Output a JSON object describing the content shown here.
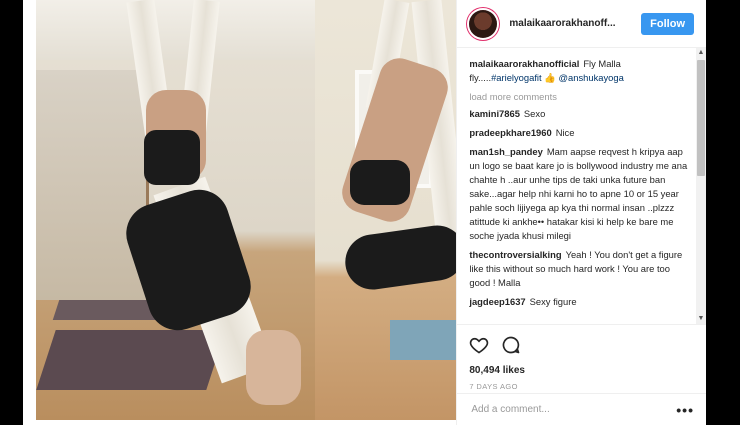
{
  "post": {
    "username": "malaikaarorakhanoff...",
    "follow_label": "Follow"
  },
  "caption": {
    "user": "malaikaarorakhanofficial",
    "text": "Fly Malla fly.....",
    "hashtag": "#arielyogafit",
    "emoji": "👍",
    "mention": "@anshukayoga"
  },
  "load_more_label": "load more comments",
  "comments": [
    {
      "user": "kamini7865",
      "text": "Sexo"
    },
    {
      "user": "pradeepkhare1960",
      "text": "Nice"
    },
    {
      "user": "man1sh_pandey",
      "text": "Mam aapse reqvest h kripya aap un logo se baat kare jo is bollywood industry me ana chahte h ..aur unhe tips de taki unka future ban sake...agar help nhi karni ho to apne 10 or 15 year pahle soch lijiyega ap kya thi normal insan ..plzzz atittude ki ankhe•• hatakar kisi ki help ke bare me soche jyada khusi milegi"
    },
    {
      "user": "thecontroversialking",
      "text": "Yeah ! You don't get a figure like this without so much hard work ! You are too good ! Malla"
    },
    {
      "user": "jagdeep1637",
      "text": "Sexy figure"
    }
  ],
  "actions": {
    "like_icon": "heart-icon",
    "comment_icon": "comment-bubble-icon",
    "likes_text": "80,494 likes",
    "date_text": "7 DAYS AGO"
  },
  "add_comment": {
    "placeholder": "Add a comment...",
    "more_label": "•••"
  },
  "colors": {
    "follow_button": "#3897f0",
    "link": "#003569",
    "muted": "#999999",
    "text": "#262626"
  }
}
